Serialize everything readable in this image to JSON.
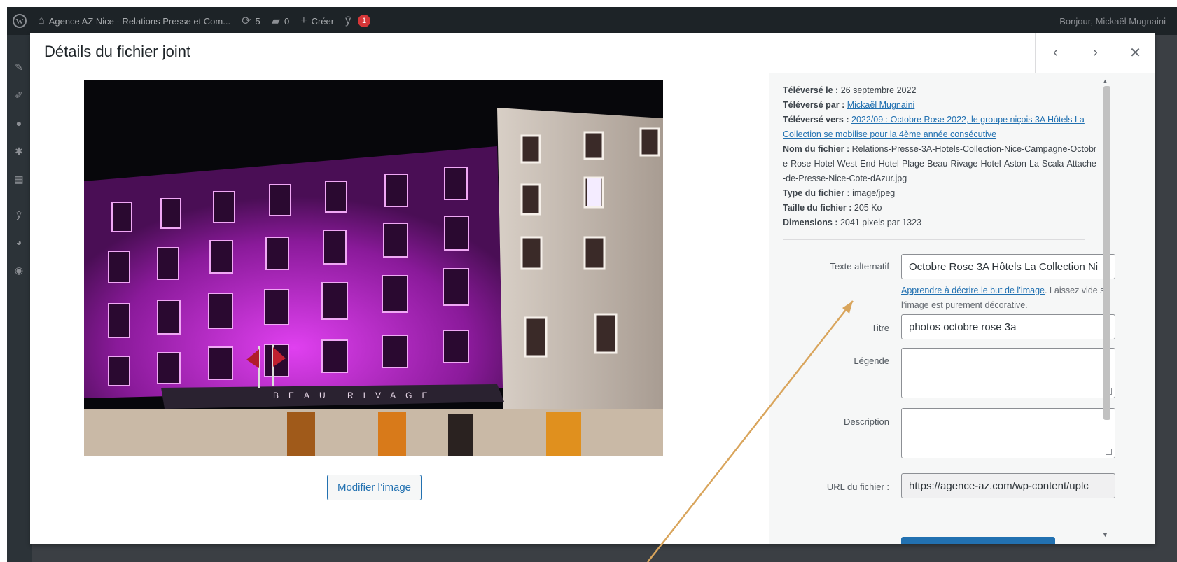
{
  "adminbar": {
    "site_title": "Agence AZ Nice - Relations Presse et Com...",
    "updates_count": "5",
    "comments_count": "0",
    "create_label": "Créer",
    "yoast_badge": "1",
    "greeting": "Bonjour, Mickaël Mugnaini"
  },
  "modal": {
    "title": "Détails du fichier joint",
    "prev_icon": "chevron-left-icon",
    "next_icon": "chevron-right-icon",
    "close_icon": "close-icon",
    "edit_image_label": "Modifier l’image",
    "photo_sign_text": "BEAU RIVAGE"
  },
  "meta": {
    "uploaded_on_label": "Téléversé le :",
    "uploaded_on_value": "26 septembre 2022",
    "uploaded_by_label": "Téléversé par :",
    "uploaded_by_value": "Mickaël Mugnaini",
    "uploaded_to_label": "Téléversé vers :",
    "uploaded_to_value": "2022/09 : Octobre Rose 2022, le groupe niçois 3A Hôtels La Collection se mobilise pour la 4ème année consécutive",
    "filename_label": "Nom du fichier :",
    "filename_value": "Relations-Presse-3A-Hotels-Collection-Nice-Campagne-Octobre-Rose-Hotel-West-End-Hotel-Plage-Beau-Rivage-Hotel-Aston-La-Scala-Attache-de-Presse-Nice-Cote-dAzur.jpg",
    "filetype_label": "Type du fichier :",
    "filetype_value": "image/jpeg",
    "filesize_label": "Taille du fichier :",
    "filesize_value": "205 Ko",
    "dimensions_label": "Dimensions :",
    "dimensions_value": "2041 pixels par 1323"
  },
  "form": {
    "alt_label": "Texte alternatif",
    "alt_value": "Octobre Rose 3A Hôtels La Collection Ni",
    "help_link": "Apprendre à décrire le but de l’image",
    "help_text": ". Laissez vide si l’image est purement décorative.",
    "title_label": "Titre",
    "title_value": "photos octobre rose 3a",
    "caption_label": "Légende",
    "caption_value": "",
    "description_label": "Description",
    "description_value": "",
    "url_label": "URL du fichier :",
    "url_value": "https://agence-az.com/wp-content/uplc"
  },
  "colors": {
    "accent": "#2271b1",
    "annotation_arrow": "#d9a55c",
    "facade_magenta": "#c02ad0"
  }
}
